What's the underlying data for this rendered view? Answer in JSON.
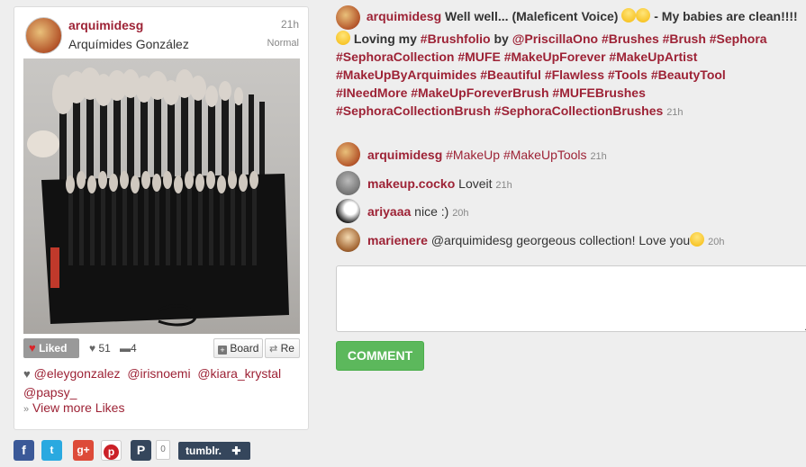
{
  "post": {
    "username": "arquimidesg",
    "fullname": "Arquímides González",
    "time": "21h",
    "filter": "Normal",
    "photo_alt": "Makeup brush collection in black roll-up case",
    "actions": {
      "liked_label": "Liked",
      "likes_count": "51",
      "comments_count": "4",
      "board_label": "Board",
      "repost_label": "Re"
    },
    "likers": [
      "@eleygonzalez",
      "@irisnoemi",
      "@kiara_krystal",
      "@papsy_"
    ],
    "view_more_label": "View more Likes",
    "share": {
      "icons": [
        "facebook-icon",
        "twitter-icon",
        "google-plus-icon",
        "pinterest-icon",
        "pinterest-p-icon"
      ],
      "count": "0",
      "tumblr_label": "tumblr."
    }
  },
  "caption": {
    "username": "arquimidesg",
    "text_1": "Well well... (Maleficent Voice)",
    "text_2": "- My babies are clean!!!!",
    "text_3": "Loving my",
    "tag_brushfolio": "#Brushfolio",
    "by": "by",
    "mention_priscilla": "@PriscillaOno",
    "tags_line": "#Brushes #Brush #Sephora #SephoraCollection #MUFE #MakeUpForever #MakeUpArtist #MakeUpByArquimides #Beautiful #Flawless #Tools #BeautyTool #INeedMore #MakeUpForeverBrush #MUFEBrushes #SephoraCollectionBrush #SephoraCollectionBrushes",
    "time": "21h"
  },
  "comments": [
    {
      "username": "arquimidesg",
      "text": "#MakeUp #MakeUpTools",
      "time": "21h"
    },
    {
      "username": "makeup.cocko",
      "text": "Loveit",
      "time": "21h"
    },
    {
      "username": "ariyaaa",
      "text": "nice :)",
      "time": "20h"
    },
    {
      "username": "marienere",
      "text": "@arquimidesg georgeous collection! Love you",
      "time": "20h"
    }
  ],
  "comment_form": {
    "placeholder": "",
    "button_label": "COMMENT"
  }
}
